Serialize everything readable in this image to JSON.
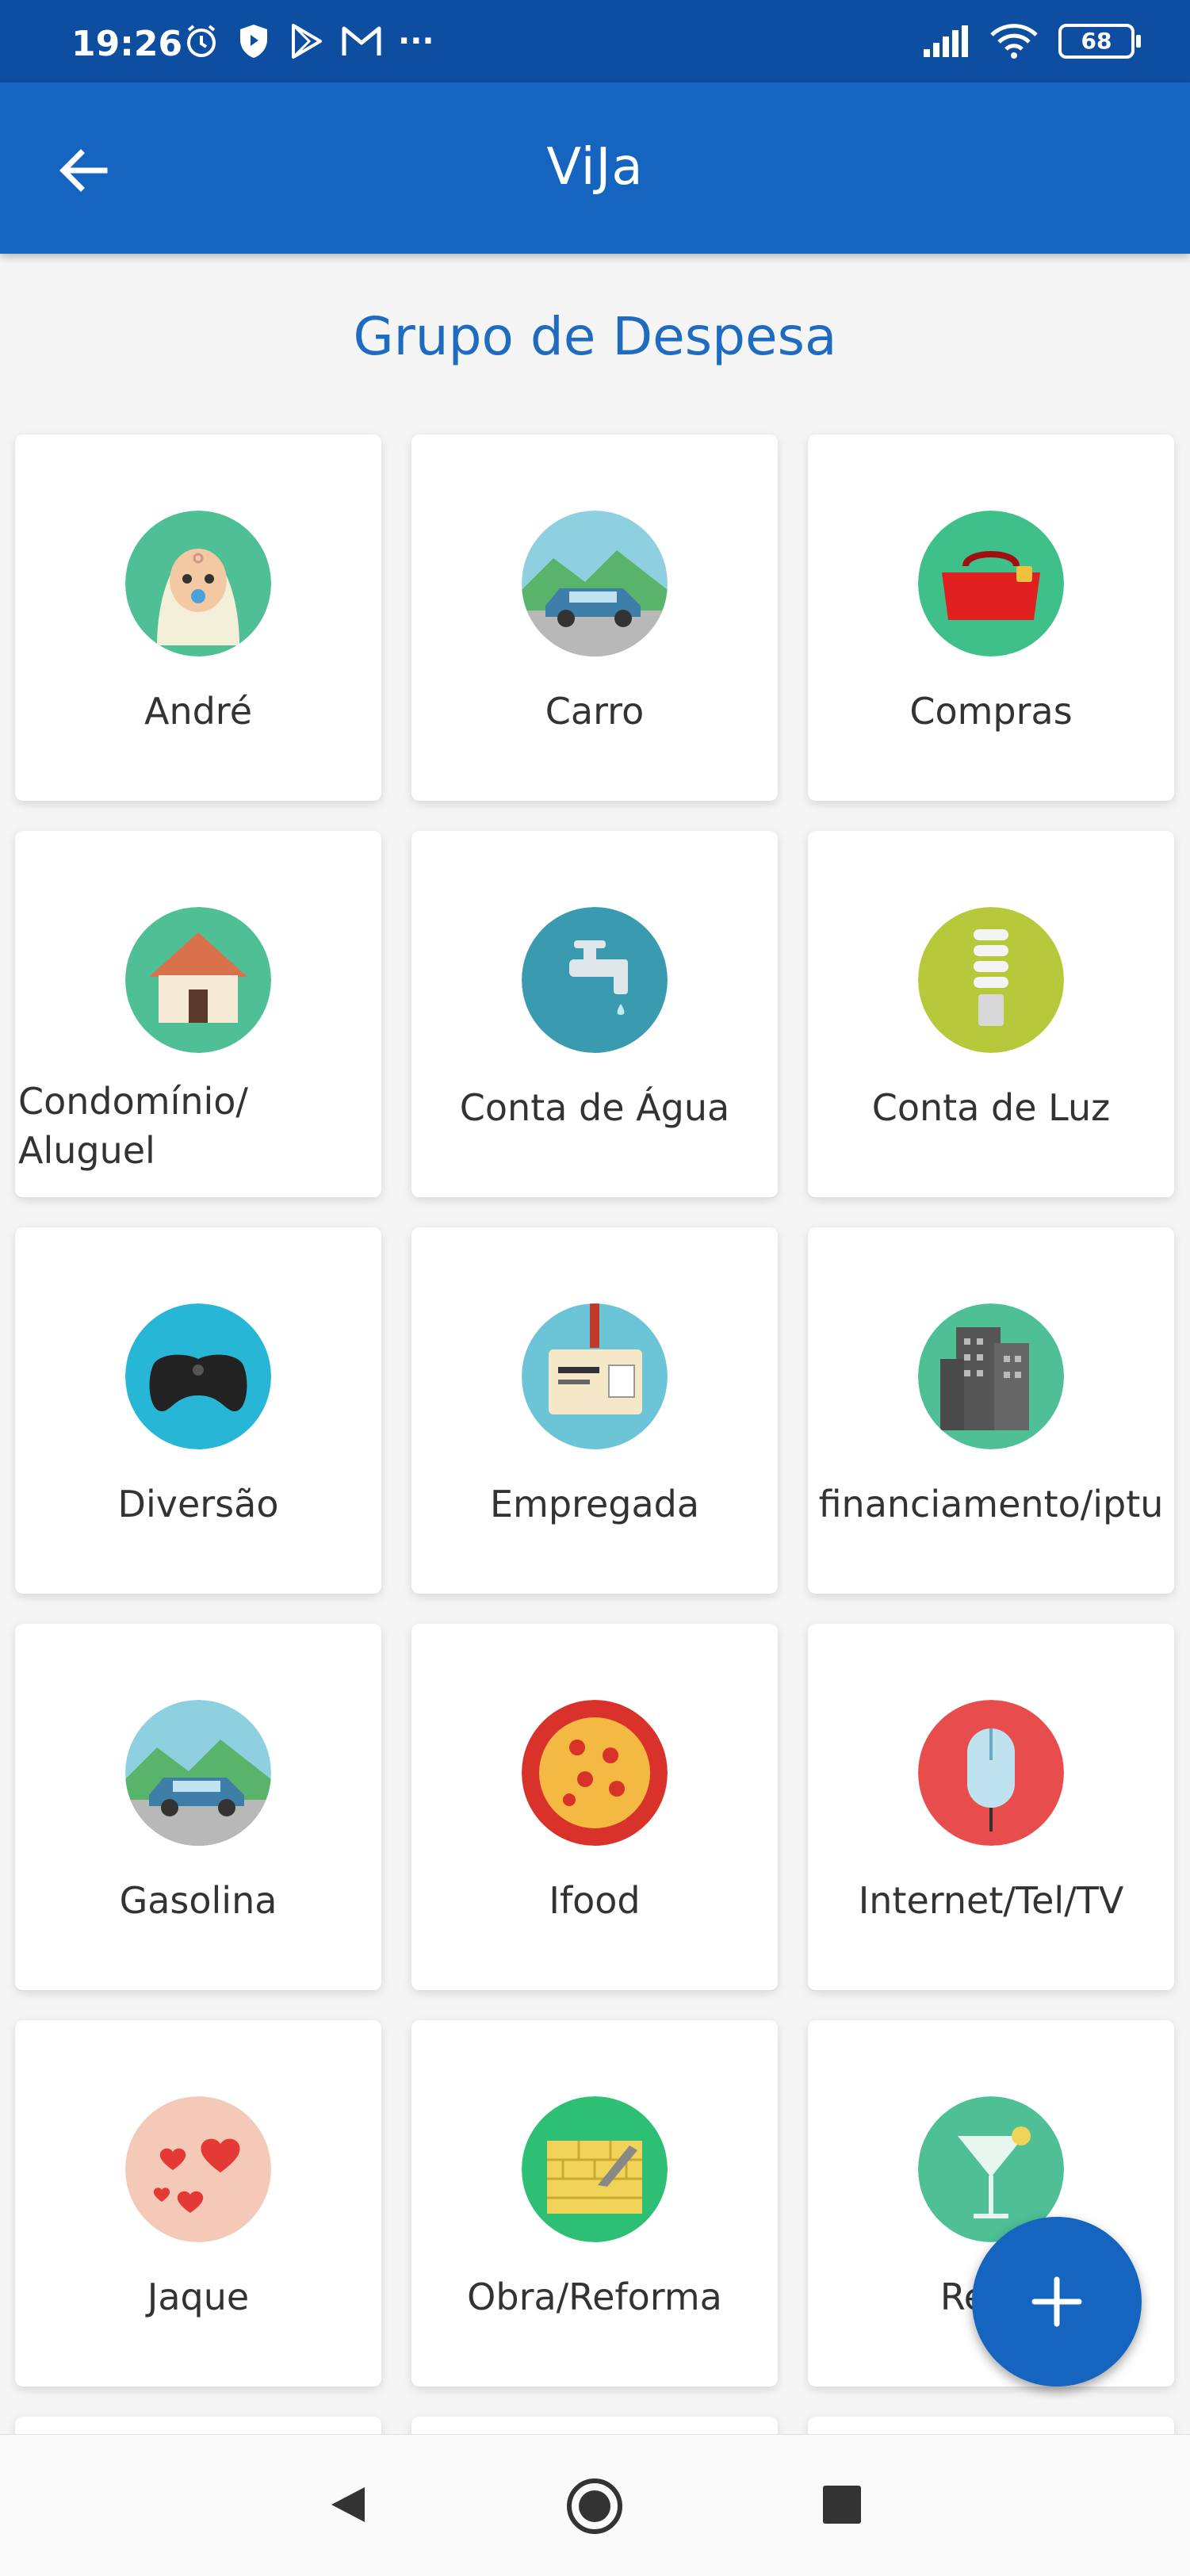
{
  "status_bar": {
    "time": "19:26",
    "battery": "68",
    "more": "···"
  },
  "app_bar": {
    "title": "ViJa"
  },
  "section_title": "Grupo de Despesa",
  "groups": [
    {
      "label": "André",
      "icon": "baby-icon",
      "bg": "#4fbf95"
    },
    {
      "label": "Carro",
      "icon": "car-icon",
      "bg": "#8fd0e0"
    },
    {
      "label": "Compras",
      "icon": "shopping-bag-icon",
      "bg": "#3fbf8a"
    },
    {
      "label": "Condomínio/\nAluguel",
      "icon": "house-icon",
      "bg": "#4fbf95"
    },
    {
      "label": "Conta de Água",
      "icon": "water-tap-icon",
      "bg": "#3a9ab0"
    },
    {
      "label": "Conta de Luz",
      "icon": "light-bulb-icon",
      "bg": "#b5c93a"
    },
    {
      "label": "Diversão",
      "icon": "game-controller-icon",
      "bg": "#27b6d6"
    },
    {
      "label": "Empregada",
      "icon": "id-badge-icon",
      "bg": "#6cc5d6"
    },
    {
      "label": "financiamento/iptu",
      "icon": "buildings-icon",
      "bg": "#4fbf95"
    },
    {
      "label": "Gasolina",
      "icon": "car-icon",
      "bg": "#8fd0e0"
    },
    {
      "label": "Ifood",
      "icon": "pizza-icon",
      "bg": "#d8322b"
    },
    {
      "label": "Internet/Tel/TV",
      "icon": "mouse-icon",
      "bg": "#e84d4d"
    },
    {
      "label": "Jaque",
      "icon": "hearts-icon",
      "bg": "#f5c9b8"
    },
    {
      "label": "Obra/Reforma",
      "icon": "brick-wall-icon",
      "bg": "#2dbf74"
    },
    {
      "label": "Resto",
      "icon": "cocktail-icon",
      "bg": "#4fbf95"
    }
  ],
  "fab": {
    "icon": "plus-icon"
  },
  "nav": {
    "back": "back-triangle-icon",
    "home": "home-circle-icon",
    "recents": "recents-square-icon"
  }
}
